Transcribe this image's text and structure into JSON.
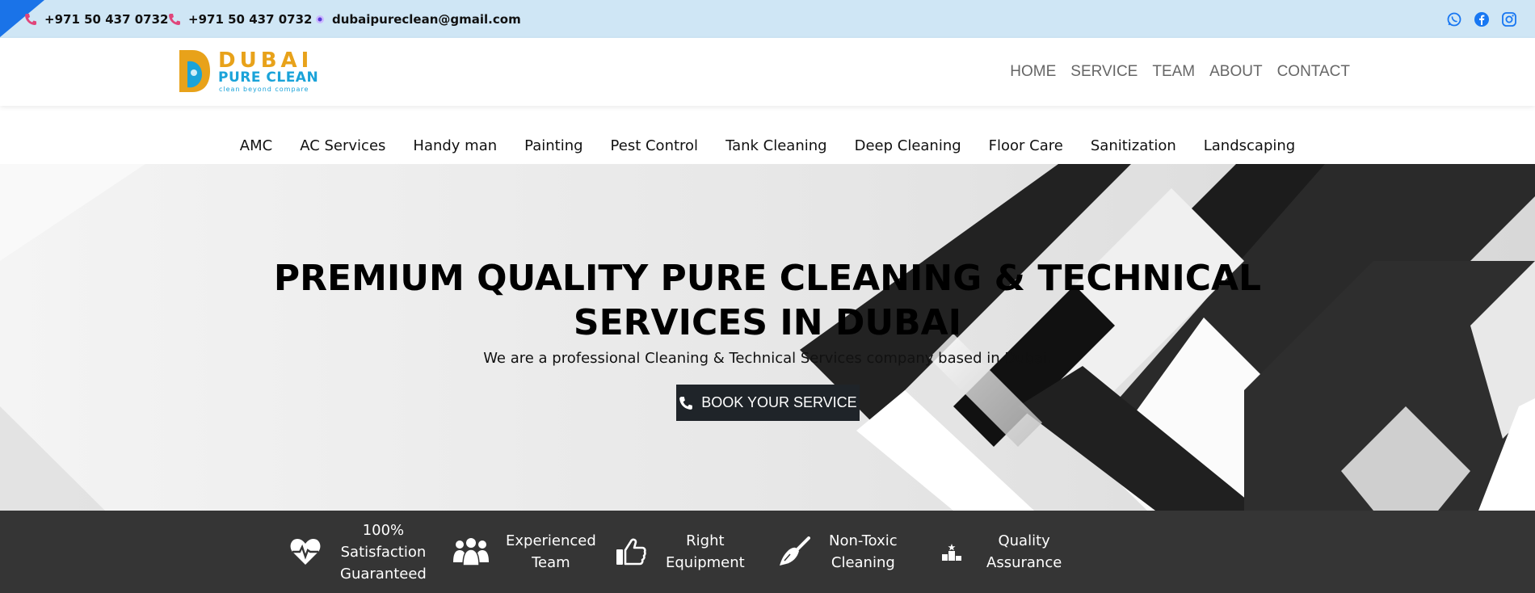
{
  "topbar": {
    "phone1": "+971 50 437 0732",
    "phone2": "+971 50 437 0732",
    "email": "dubaipureclean@gmail.com",
    "social_icons": [
      "whatsapp-icon",
      "facebook-icon",
      "instagram-icon"
    ]
  },
  "logo": {
    "word1": "DUBAI",
    "word2": "PURE CLEAN",
    "tagline": "clean beyond compare"
  },
  "main_nav": [
    "HOME",
    "SERVICE",
    "TEAM",
    "ABOUT",
    "CONTACT"
  ],
  "service_nav": [
    "AMC",
    "AC Services",
    "Handy man",
    "Painting",
    "Pest Control",
    "Tank Cleaning",
    "Deep Cleaning",
    "Floor Care",
    "Sanitization",
    "Landscaping"
  ],
  "hero": {
    "title": "PREMIUM QUALITY PURE CLEANING & TECHNICAL SERVICES IN DUBAI",
    "subtitle": "We are a professional Cleaning & Technical Services company based in Dubai.",
    "cta_label": "BOOK YOUR SERVICE"
  },
  "features": [
    {
      "icon": "heart-pulse-icon",
      "label": "100%\nSatisfaction\nGuaranteed"
    },
    {
      "icon": "team-icon",
      "label": "Experienced\nTeam"
    },
    {
      "icon": "thumbs-up-icon",
      "label": "Right\nEquipment"
    },
    {
      "icon": "broom-icon",
      "label": "Non-Toxic\nCleaning"
    },
    {
      "icon": "podium-star-icon",
      "label": "Quality\nAssurance"
    }
  ],
  "colors": {
    "topbar_bg": "#cfe6f5",
    "accent_blue": "#1a73e8",
    "phone_icon": "#e0457b",
    "logo_gold": "#e8a21a",
    "logo_blue": "#1aa3d9",
    "cta_bg": "#1f2429",
    "features_bg": "#353535"
  }
}
